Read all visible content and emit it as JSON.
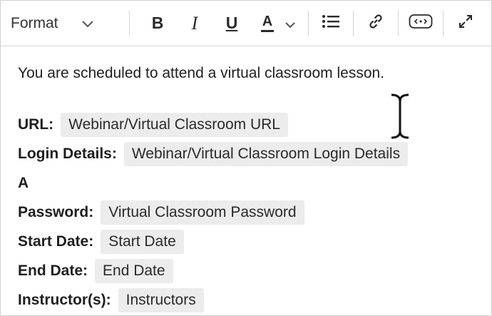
{
  "toolbar": {
    "format_label": "Format",
    "bold_label": "B",
    "italic_label": "I",
    "underline_label": "U",
    "text_color_label": "A"
  },
  "body": {
    "intro": "You are scheduled to attend a virtual classroom lesson.",
    "fields": [
      {
        "label": "URL:",
        "value": "Webinar/Virtual Classroom URL"
      },
      {
        "label": "Login Details:",
        "value": "Webinar/Virtual Classroom Login Details"
      },
      {
        "label": "Password:",
        "value": "Virtual Classroom Password"
      },
      {
        "label": "Start Date:",
        "value": "Start Date"
      },
      {
        "label": "End Date:",
        "value": "End Date"
      },
      {
        "label": "Instructor(s):",
        "value": "Instructors"
      }
    ],
    "stray_line": "A"
  },
  "icons": {
    "format_dropdown": "chevron-down-icon",
    "text_color_dropdown": "chevron-down-icon",
    "list": "bullet-list-icon",
    "link": "link-icon",
    "embed": "embed-icon",
    "expand": "expand-icon",
    "cursor": "text-cursor-icon"
  }
}
